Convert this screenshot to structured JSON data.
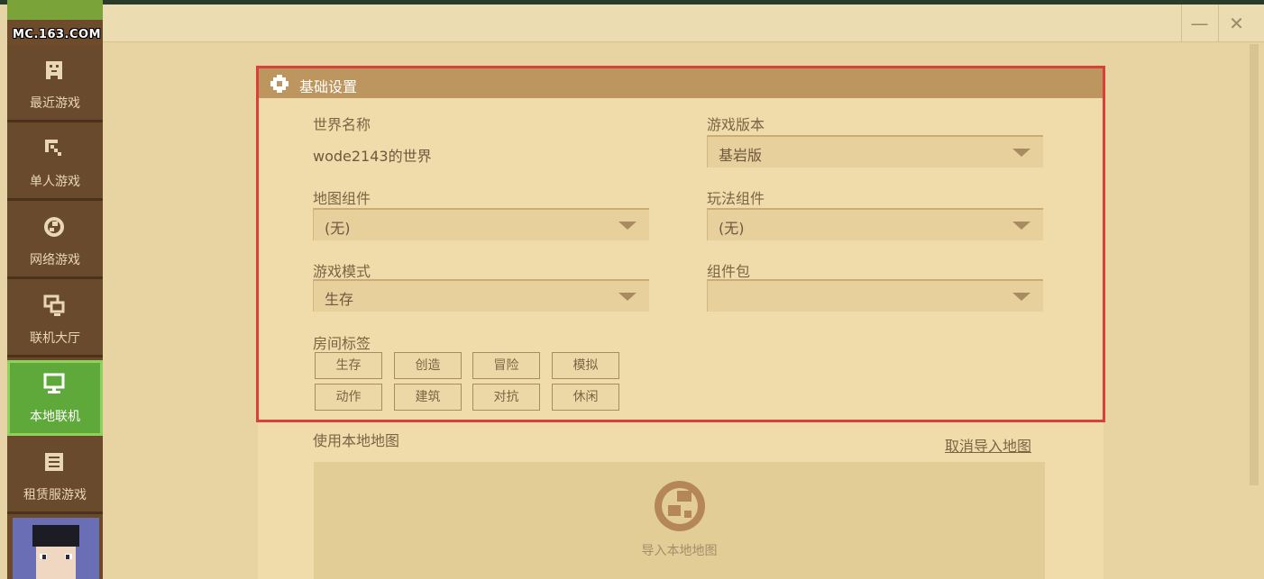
{
  "sidebar": {
    "logo_text": "MC.163.COM",
    "items": [
      {
        "label": "最近游戏",
        "icon": "gamepad-icon"
      },
      {
        "label": "单人游戏",
        "icon": "pickaxe-icon"
      },
      {
        "label": "网络游戏",
        "icon": "globe-icon"
      },
      {
        "label": "联机大厅",
        "icon": "network-icon"
      },
      {
        "label": "本地联机",
        "icon": "monitor-icon",
        "active": true
      },
      {
        "label": "租赁服游戏",
        "icon": "list-icon"
      }
    ]
  },
  "window": {
    "minimize": "—",
    "close": "✕"
  },
  "basic_settings": {
    "title": "基础设置",
    "world_name_label": "世界名称",
    "world_name_value": "wode2143的世界",
    "game_version_label": "游戏版本",
    "game_version_value": "基岩版",
    "map_component_label": "地图组件",
    "map_component_value": "(无)",
    "gameplay_component_label": "玩法组件",
    "gameplay_component_value": "(无)",
    "game_mode_label": "游戏模式",
    "game_mode_value": "生存",
    "component_pack_label": "组件包",
    "component_pack_value": "",
    "room_tags_label": "房间标签",
    "room_tags": [
      "生存",
      "创造",
      "冒险",
      "模拟",
      "动作",
      "建筑",
      "对抗",
      "休闲"
    ]
  },
  "local_map": {
    "label": "使用本地地图",
    "cancel_link": "取消导入地图",
    "import_label": "导入本地地图"
  },
  "colors": {
    "accent_red": "#d94037",
    "sidebar_active": "#5fa93a",
    "header_brown": "#bd965f"
  }
}
